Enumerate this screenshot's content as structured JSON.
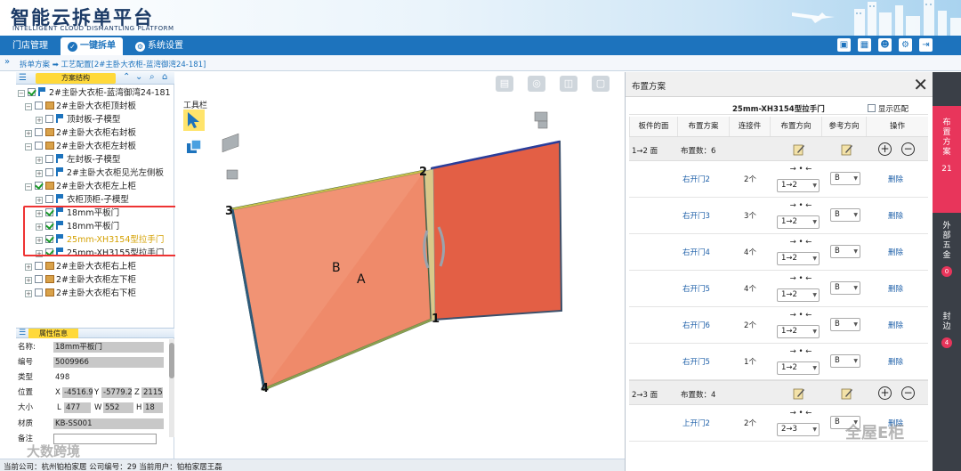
{
  "header": {
    "title_cn": "智能云拆单平台",
    "title_en": "INTELLIGENT CLOUD DISMANTLING PLATFORM"
  },
  "nav": {
    "tabs": [
      {
        "label": "门店管理"
      },
      {
        "label": "一键拆单"
      },
      {
        "label": "系统设置"
      }
    ]
  },
  "breadcrumb": "拆单方案 ➡ 工艺配置[2#主卧大衣柜-蓝湾御湾24-181]",
  "tree_panel": {
    "title": "方案结构",
    "items": [
      {
        "label": "2#主卧大衣柜-蓝湾御湾24-181"
      },
      {
        "label": "2#主卧大衣柜顶封板"
      },
      {
        "label": "顶封板-子模型"
      },
      {
        "label": "2#主卧大衣柜右封板"
      },
      {
        "label": "2#主卧大衣柜左封板"
      },
      {
        "label": "左封板-子模型"
      },
      {
        "label": "2#主卧大衣柜见光左侧板"
      },
      {
        "label": "2#主卧大衣柜左上柜"
      },
      {
        "label": "衣柜顶柜-子模型"
      },
      {
        "label": "18mm平板门"
      },
      {
        "label": "18mm平板门"
      },
      {
        "label": "25mm-XH3154型拉手门"
      },
      {
        "label": "25mm-XH3155型拉手门"
      },
      {
        "label": "2#主卧大衣柜右上柜"
      },
      {
        "label": "2#主卧大衣柜左下柜"
      },
      {
        "label": "2#主卧大衣柜右下柜"
      }
    ]
  },
  "attr_panel": {
    "title": "属性信息",
    "name_label": "名称:",
    "name_value": "18mm平板门",
    "code_label": "编号",
    "code_value": "5009966",
    "type_label": "类型",
    "type_value": "498",
    "pos_label": "位置",
    "pos_x_label": "X",
    "pos_x": "-4516.9",
    "pos_y_label": "Y",
    "pos_y": "-5779.2",
    "pos_z_label": "Z",
    "pos_z": "2115",
    "size_label": "大小",
    "size_l_label": "L",
    "size_l": "477",
    "size_w_label": "W",
    "size_w": "552",
    "size_h_label": "H",
    "size_h": "18",
    "material_label": "材质",
    "material_value": "KB-SS001",
    "note_label": "备注"
  },
  "viewport": {
    "toolbox_label": "工具栏",
    "labels": {
      "p1": "1",
      "p2": "2",
      "p3": "3",
      "p4": "4",
      "a": "A",
      "b": "B"
    }
  },
  "layout_panel": {
    "title": "布置方案",
    "subtitle": "25mm-XH3154型拉手门",
    "show_match": "显示匹配",
    "columns": [
      "板件的面",
      "布置方案",
      "连接件",
      "布置方向",
      "参考方向",
      "操作"
    ],
    "groups": [
      {
        "face": "1→2 面",
        "count": "布置数：6",
        "rows": [
          {
            "name": "右开门2",
            "qty": "2个",
            "dir": "1→2",
            "ref": "B",
            "op": "删除"
          },
          {
            "name": "右开门3",
            "qty": "3个",
            "dir": "1→2",
            "ref": "B",
            "op": "删除"
          },
          {
            "name": "右开门4",
            "qty": "4个",
            "dir": "1→2",
            "ref": "B",
            "op": "删除"
          },
          {
            "name": "右开门5",
            "qty": "4个",
            "dir": "1→2",
            "ref": "B",
            "op": "删除"
          },
          {
            "name": "右开门6",
            "qty": "2个",
            "dir": "1→2",
            "ref": "B",
            "op": "删除"
          },
          {
            "name": "右开门5",
            "qty": "1个",
            "dir": "1→2",
            "ref": "B",
            "op": "删除"
          }
        ]
      },
      {
        "face": "2→3 面",
        "count": "布置数：4",
        "rows": [
          {
            "name": "上开门2",
            "qty": "2个",
            "dir": "2→3",
            "ref": "B",
            "op": "删除"
          }
        ]
      }
    ],
    "arrow_glyph": "→ • ←"
  },
  "right_sidebar": {
    "tabs": [
      {
        "label": "布置方案",
        "count": "21"
      },
      {
        "label": "外部五金",
        "count": "0"
      },
      {
        "label": "封边",
        "count": "4"
      }
    ]
  },
  "footer": "当前公司：杭州铂柏家居   公司编号：29   当前用户：铂柏家居王磊",
  "watermarks": [
    "大数跨境",
    "全屋E柜"
  ]
}
